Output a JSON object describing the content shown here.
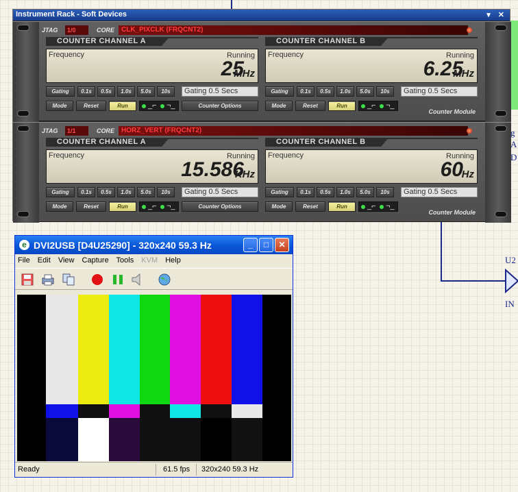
{
  "rack": {
    "title": "Instrument Rack - Soft Devices",
    "title_controls": "▾ ✕",
    "modules": [
      {
        "jtag_label": "JTAG",
        "jtag_value": "1/0",
        "core_label": "CORE",
        "core_value": "CLK_PIXCLK (FRQCNT2)",
        "footer_label": "Counter Module",
        "channels": [
          {
            "header": "COUNTER CHANNEL A",
            "freq_label": "Frequency",
            "status": "Running",
            "value": "25",
            "unit": "MHz",
            "gating_label": "Gating",
            "gating_buttons": [
              "0.1s",
              "0.5s",
              "1.0s",
              "5.0s",
              "10s"
            ],
            "gating_display": "Gating  0.5 Secs",
            "mode": "Mode",
            "reset": "Reset",
            "run": "Run",
            "options": "Counter Options"
          },
          {
            "header": "COUNTER CHANNEL B",
            "freq_label": "Frequency",
            "status": "Running",
            "value": "6.25",
            "unit": "MHz",
            "gating_label": "Gating",
            "gating_buttons": [
              "0.1s",
              "0.5s",
              "1.0s",
              "5.0s",
              "10s"
            ],
            "gating_display": "Gating  0.5 Secs",
            "mode": "Mode",
            "reset": "Reset",
            "run": "Run"
          }
        ]
      },
      {
        "jtag_label": "JTAG",
        "jtag_value": "1/1",
        "core_label": "CORE",
        "core_value": "HORZ_VERT (FRQCNT2)",
        "footer_label": "Counter Module",
        "channels": [
          {
            "header": "COUNTER CHANNEL A",
            "freq_label": "Frequency",
            "status": "Running",
            "value": "15.586",
            "unit": "KHz",
            "gating_label": "Gating",
            "gating_buttons": [
              "0.1s",
              "0.5s",
              "1.0s",
              "5.0s",
              "10s"
            ],
            "gating_display": "Gating  0.5 Secs",
            "mode": "Mode",
            "reset": "Reset",
            "run": "Run",
            "options": "Counter Options"
          },
          {
            "header": "COUNTER CHANNEL B",
            "freq_label": "Frequency",
            "status": "Running",
            "value": "60",
            "unit": "Hz",
            "gating_label": "Gating",
            "gating_buttons": [
              "0.1s",
              "0.5s",
              "1.0s",
              "5.0s",
              "10s"
            ],
            "gating_display": "Gating  0.5 Secs",
            "mode": "Mode",
            "reset": "Reset",
            "run": "Run"
          }
        ]
      }
    ]
  },
  "schematic": {
    "part_label": "U2",
    "pin_label": "IN",
    "partial_text": [
      "g",
      "A",
      "D"
    ]
  },
  "window": {
    "title": "DVI2USB [D4U25290]  - 320x240 59.3 Hz",
    "menu": [
      "File",
      "Edit",
      "View",
      "Capture",
      "Tools",
      "KVM",
      "Help"
    ],
    "toolbar_icons": [
      "save-icon",
      "print-icon",
      "copy-icon",
      "record-icon",
      "pause-icon",
      "speaker-icon",
      "globe-icon"
    ],
    "status": {
      "left": "Ready",
      "fps": "61.5 fps",
      "mode": "320x240 59.3 Hz"
    },
    "bars_top": [
      "#000000",
      "#e8e8e8",
      "#ecec10",
      "#10e6e6",
      "#10d810",
      "#e010e0",
      "#ee1010",
      "#1010e8",
      "#000000"
    ],
    "bars_mid": [
      "#000000",
      "#1010e8",
      "#101010",
      "#e010e0",
      "#101010",
      "#10e6e6",
      "#101010",
      "#e8e8e8",
      "#000000"
    ],
    "bars_bottom": [
      "#000000",
      "#0a0a3a",
      "#ffffff",
      "#2a0a3a",
      "#101010",
      "#101010",
      "#000000",
      "#121212",
      "#000000"
    ]
  }
}
